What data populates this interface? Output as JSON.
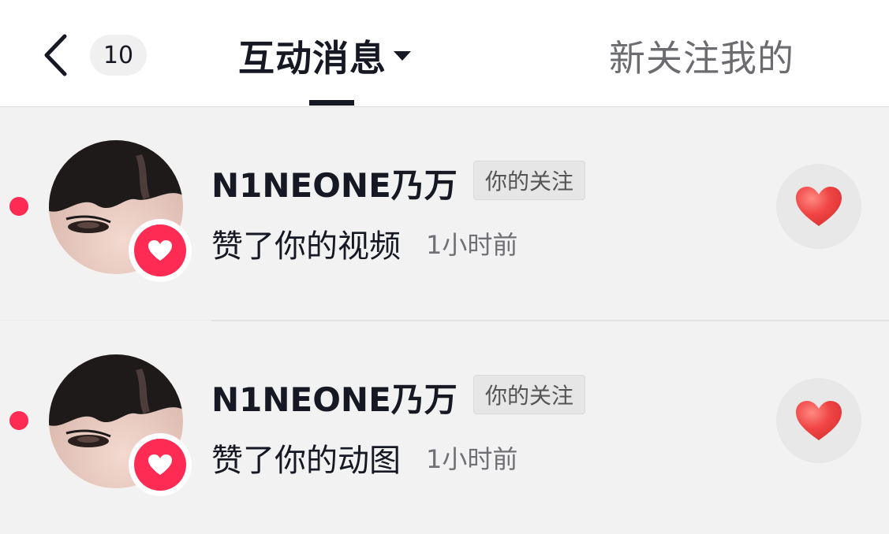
{
  "header": {
    "unread_count": "10",
    "title": "互动消息",
    "follow_tab": "新关注我的"
  },
  "notifications": [
    {
      "username": "N1NEONE乃万",
      "tag": "你的关注",
      "action": "赞了你的视频",
      "time": "1小时前",
      "unread": true
    },
    {
      "username": "N1NEONE乃万",
      "tag": "你的关注",
      "action": "赞了你的动图",
      "time": "1小时前",
      "unread": true
    }
  ],
  "icons": [
    "back-arrow-icon",
    "caret-down-icon",
    "heart-icon"
  ],
  "colors": {
    "accent": "#fe2c55",
    "heart": "#f04545",
    "background": "#f2f2f2",
    "header_bg": "#ffffff"
  }
}
